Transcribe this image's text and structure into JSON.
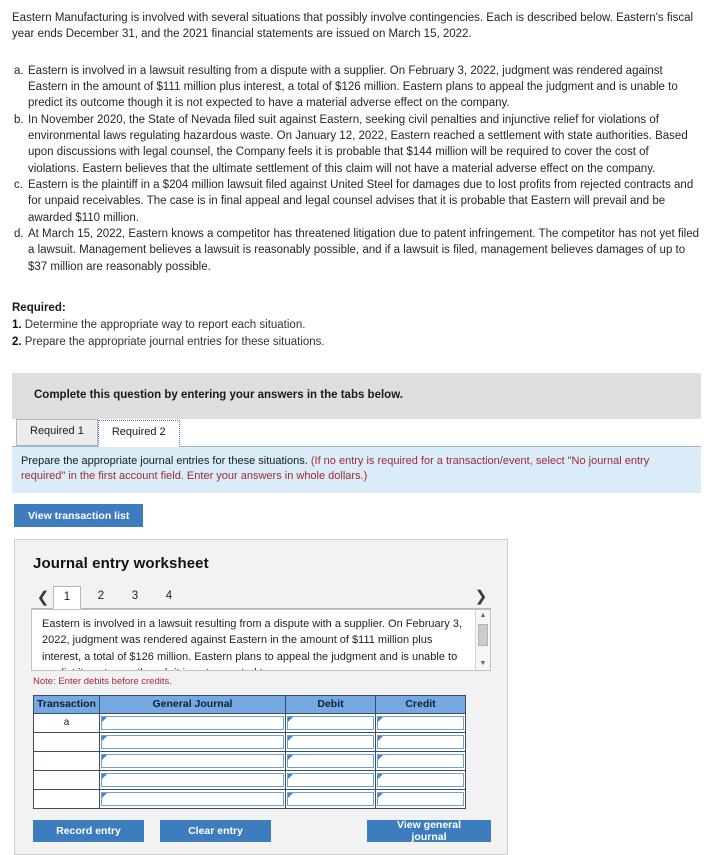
{
  "intro": "Eastern Manufacturing is involved with several situations that possibly involve contingencies. Each is described below. Eastern's fiscal year ends December 31, and the 2021 financial statements are issued on March 15, 2022.",
  "situations": [
    {
      "letter": "a.",
      "text": "Eastern is involved in a lawsuit resulting from a dispute with a supplier. On February 3, 2022, judgment was rendered against Eastern in the amount of $111 million plus interest, a total of $126 million. Eastern plans to appeal the judgment and is unable to predict its outcome though it is not expected to have a material adverse effect on the company."
    },
    {
      "letter": "b.",
      "text": "In November 2020, the State of Nevada filed suit against Eastern, seeking civil penalties and injunctive relief for violations of environmental laws regulating hazardous waste. On January 12, 2022, Eastern reached a settlement with state authorities. Based upon discussions with legal counsel, the Company feels it is probable that $144 million will be required to cover the cost of violations. Eastern believes that the ultimate settlement of this claim will not have a material adverse effect on the company."
    },
    {
      "letter": "c.",
      "text": "Eastern is the plaintiff in a $204 million lawsuit filed against United Steel for damages due to lost profits from rejected contracts and for unpaid receivables. The case is in final appeal and legal counsel advises that it is probable that Eastern will prevail and be awarded $110 million."
    },
    {
      "letter": "d.",
      "text": "At March 15, 2022, Eastern knows a competitor has threatened litigation due to patent infringement. The competitor has not yet filed a lawsuit. Management believes a lawsuit is reasonably possible, and if a lawsuit is filed, management believes damages of up to $37 million are reasonably possible."
    }
  ],
  "required": {
    "title": "Required:",
    "item1_num": "1.",
    "item1_text": "Determine the appropriate way to report each situation.",
    "item2_num": "2.",
    "item2_text": "Prepare the appropriate journal entries for these situations."
  },
  "complete_bar": {
    "text": "Complete this question by entering your answers in the tabs below."
  },
  "tabs": [
    {
      "label": "Required 1",
      "active": false
    },
    {
      "label": "Required 2",
      "active": true
    }
  ],
  "instruction": {
    "lead": "Prepare the appropriate journal entries for these situations.",
    "paren": "(If no entry is required for a transaction/event, select \"No journal entry required\" in the first account field. Enter your answers in whole dollars.)"
  },
  "view_transaction_list_label": "View transaction list",
  "worksheet": {
    "title": "Journal entry worksheet",
    "prev_icon": "chevron-left-icon",
    "next_icon": "chevron-right-icon",
    "entry_tabs": [
      "1",
      "2",
      "3",
      "4"
    ],
    "active_entry_tab": "1",
    "description": "Eastern is involved in a lawsuit resulting from a dispute with a supplier. On February 3, 2022, judgment was rendered against Eastern in the amount of $111 million plus interest, a total of $126 million. Eastern plans to appeal the judgment and is unable to predict its outcome though it is not expected to",
    "note": "Note: Enter debits before credits.",
    "table": {
      "headers": [
        "Transaction",
        "General Journal",
        "Debit",
        "Credit"
      ],
      "rows": [
        {
          "transaction": "a",
          "general_journal": "",
          "debit": "",
          "credit": ""
        },
        {
          "transaction": "",
          "general_journal": "",
          "debit": "",
          "credit": ""
        },
        {
          "transaction": "",
          "general_journal": "",
          "debit": "",
          "credit": ""
        },
        {
          "transaction": "",
          "general_journal": "",
          "debit": "",
          "credit": ""
        },
        {
          "transaction": "",
          "general_journal": "",
          "debit": "",
          "credit": ""
        }
      ]
    },
    "buttons": {
      "record": "Record entry",
      "clear": "Clear entry",
      "view_general_journal": "View general journal"
    }
  },
  "colors": {
    "button_blue": "#3d7dbe",
    "table_header_blue": "#74a9e4",
    "info_bar_blue": "#d9ecf7",
    "note_maroon": "#9e2a35",
    "grey_bar": "#dedede"
  }
}
